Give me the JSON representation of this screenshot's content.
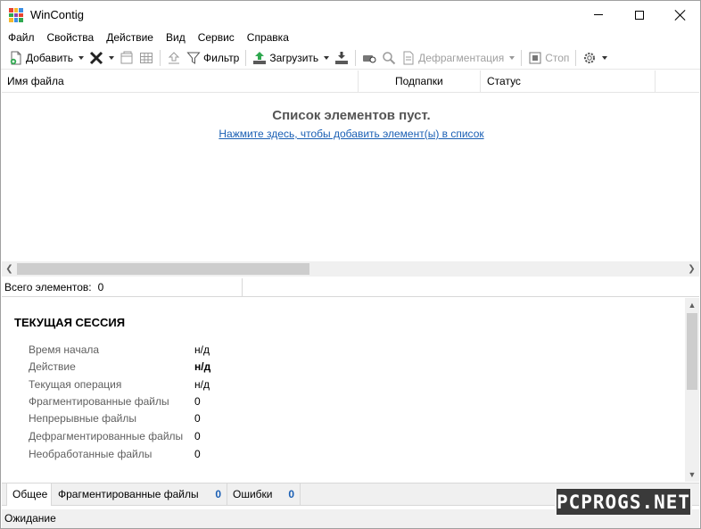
{
  "window": {
    "title": "WinContig",
    "icon": "wincontig-app-icon",
    "icon_colors": [
      "#e8432f",
      "#f6b82c",
      "#3b8ee4",
      "#2fa84f",
      "#8e44ad",
      "#e8432f",
      "#f6b82c",
      "#3b8ee4",
      "#2fa84f"
    ]
  },
  "menu": {
    "items": [
      "Файл",
      "Свойства",
      "Действие",
      "Вид",
      "Сервис",
      "Справка"
    ]
  },
  "toolbar": {
    "add_label": "Добавить",
    "filter_label": "Фильтр",
    "load_label": "Загрузить",
    "defrag_label": "Дефрагментация",
    "stop_label": "Стоп",
    "icons": [
      "add-file-icon",
      "delete-x-icon",
      "select-all-icon",
      "grid-icon",
      "move-up-icon",
      "filter-icon",
      "load-icon",
      "save-icon",
      "key-icon",
      "search-icon",
      "defrag-icon",
      "stop-icon",
      "gear-icon"
    ]
  },
  "list": {
    "columns": [
      "Имя файла",
      "Подпапки",
      "Статус"
    ],
    "empty_title": "Список элементов пуст.",
    "empty_link": "Нажмите здесь, чтобы добавить элемент(ы) в список"
  },
  "count": {
    "label": "Всего элементов:",
    "value": "0"
  },
  "session": {
    "title": "ТЕКУЩАЯ СЕССИЯ",
    "rows": [
      {
        "label": "Время начала",
        "value": "н/д"
      },
      {
        "label": "Действие",
        "value": "н/д"
      },
      {
        "label": "Текущая операция",
        "value": "н/д"
      },
      {
        "label": "Фрагментированные файлы",
        "value": "0"
      },
      {
        "label": "Непрерывные файлы",
        "value": "0"
      },
      {
        "label": "Дефрагментированные файлы",
        "value": "0"
      },
      {
        "label": "Необработанные файлы",
        "value": "0"
      }
    ]
  },
  "tabs": {
    "general": "Общее",
    "fragmented": "Фрагментированные файлы",
    "fragmented_count": "0",
    "errors": "Ошибки",
    "errors_count": "0"
  },
  "status": {
    "text": "Ожидание"
  },
  "watermark": {
    "text": "PCPROGS.NET"
  },
  "colors": {
    "link": "#1a5fb4",
    "count_accent": "#1a5fb4",
    "empty_title": "#555555"
  }
}
